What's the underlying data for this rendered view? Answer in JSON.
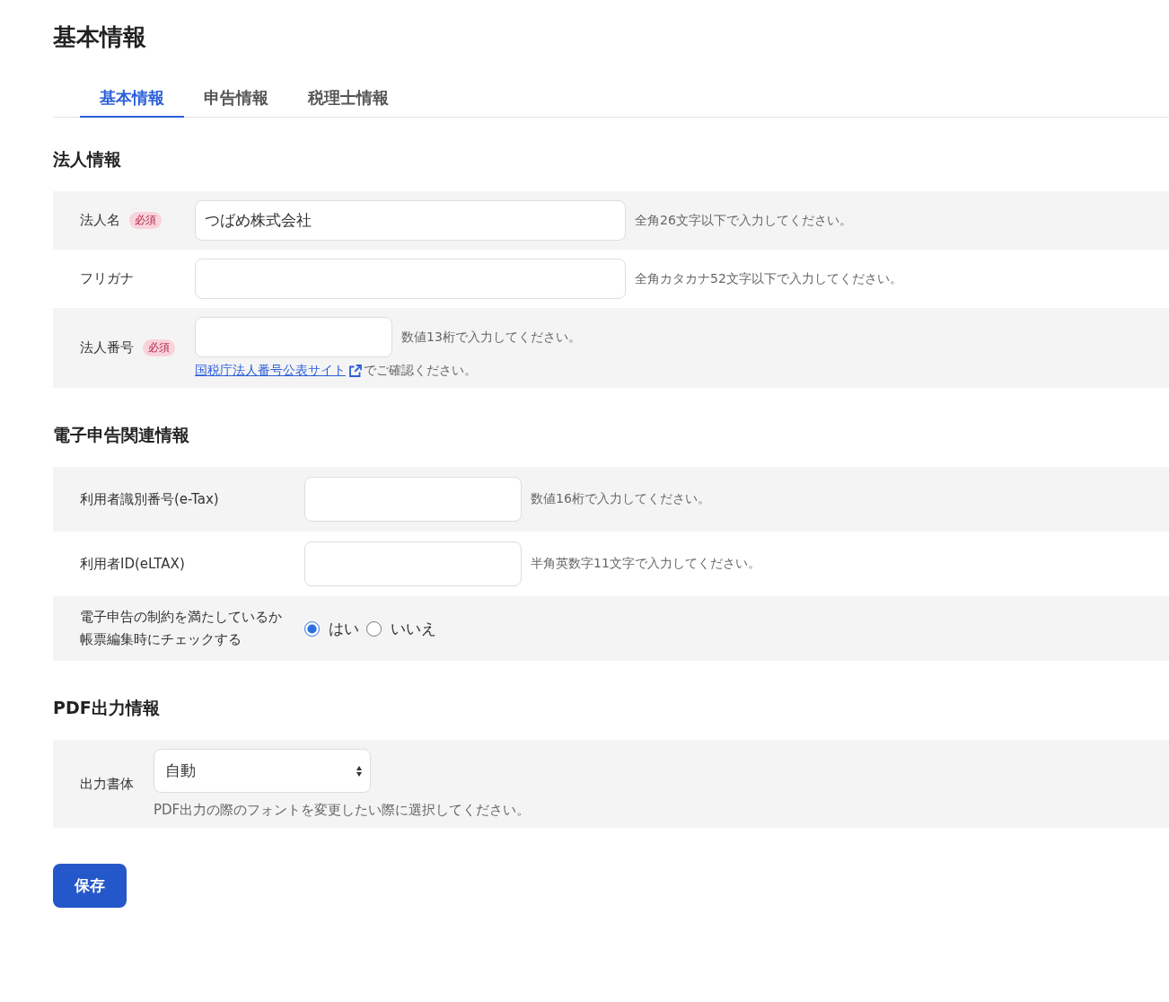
{
  "page_title": "基本情報",
  "tabs": [
    {
      "label": "基本情報",
      "selected": true
    },
    {
      "label": "申告情報",
      "selected": false
    },
    {
      "label": "税理士情報",
      "selected": false
    }
  ],
  "sections": [
    {
      "title": "法人情報",
      "rows": [
        {
          "kind": "long_text",
          "label": "法人名",
          "badge": "必須",
          "value": "つばめ株式会社",
          "hint": "全角26文字以下で入力してください。"
        },
        {
          "kind": "long_text",
          "label": "フリガナ",
          "value": "",
          "hint": "全角カタカナ52文字以下で入力してください。"
        },
        {
          "kind": "short_text",
          "label": "法人番号",
          "badge": "必須",
          "value": "",
          "hint": "数値13桁で入力してください。",
          "note": {
            "link": "国税庁法人番号公表サイト",
            "text": "でご確認ください。"
          }
        }
      ]
    },
    {
      "title": "電子申告関連情報",
      "rows": [
        {
          "kind": "medium_text",
          "label": "利用者識別番号(e-Tax)",
          "value": "",
          "hint": "数値16桁で入力してください。"
        },
        {
          "kind": "medium_text",
          "label": "利用者ID(eLTAX)",
          "value": "",
          "hint": "半角英数字11文字で入力してください。"
        },
        {
          "kind": "radio",
          "label": "電子申告の制約を満たしているか帳票編集時にチェックする",
          "options": [
            {
              "label": "はい",
              "selected": true
            },
            {
              "label": "いいえ",
              "selected": false
            }
          ]
        }
      ]
    },
    {
      "title": "PDF出力情報",
      "rows": [
        {
          "kind": "select",
          "label": "出力書体",
          "value": "自動",
          "note": {
            "text": "PDF出力の際のフォントを変更したい際に選択してください。"
          }
        }
      ]
    }
  ],
  "save_button": "保存"
}
